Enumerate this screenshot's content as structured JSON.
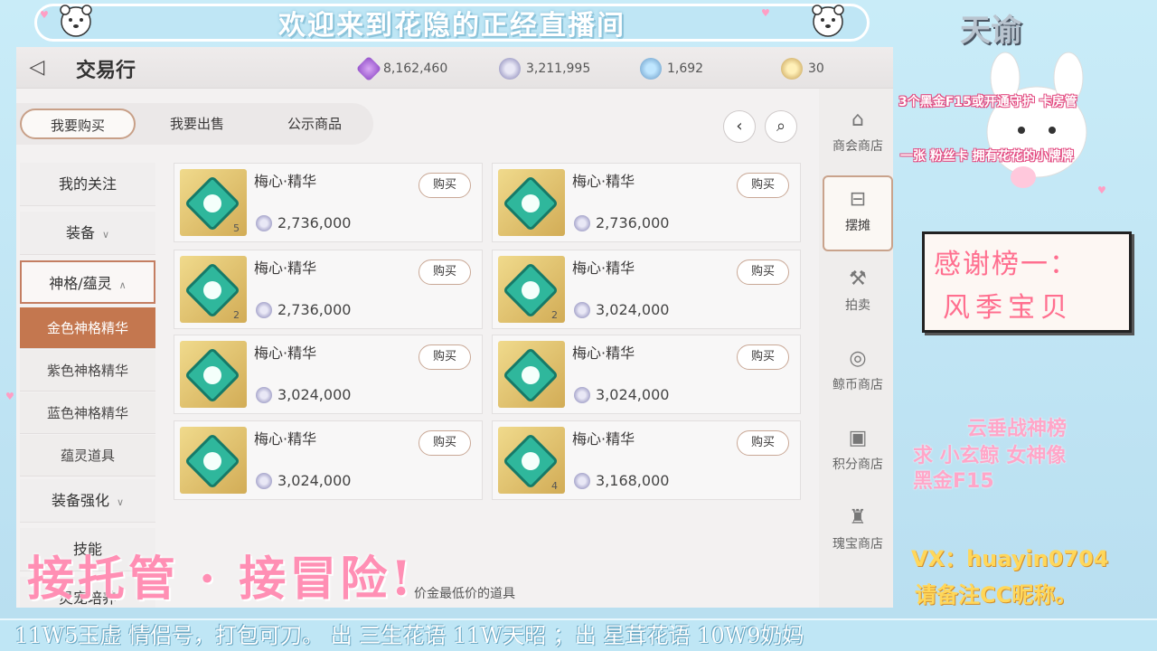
{
  "stream": {
    "banner_title": "欢迎来到花隐的正经直播间",
    "overlay_big": "接托管 · 接冒险!",
    "ticker": "11W5玉虚   情侣号，打包可刀。    出  三生花语  11W天昭 ；出  星茸花语  10W9奶妈",
    "logo": "天谕",
    "right_note_1": "3个黑金F15或开通守护 卡房管",
    "right_note_2": "一张 粉丝卡 拥有花花的小牌牌",
    "thanks_title": "感谢榜一：",
    "thanks_name": "风季宝贝",
    "pink_line_1": "云垂战神榜",
    "pink_line_2": "求   小玄鲸 女神像",
    "pink_line_3": "黑金F15",
    "vx_line_1": "VX：huayin0704",
    "vx_line_2": "请备注CC昵称。"
  },
  "game": {
    "title": "交易行",
    "currencies": [
      {
        "icon": "purple-crystal-icon",
        "value": "8,162,460"
      },
      {
        "icon": "silver-coin-icon",
        "value": "3,211,995"
      },
      {
        "icon": "blue-coin-icon",
        "value": "1,692"
      },
      {
        "icon": "gold-coin-icon",
        "value": "30"
      }
    ],
    "tabs": [
      "我要购买",
      "我要出售",
      "公示商品"
    ],
    "sidebar": {
      "follow": "我的关注",
      "equipment": "装备",
      "divinity": "神格/蕴灵",
      "subs": [
        "金色神格精华",
        "紫色神格精华",
        "蓝色神格精华",
        "蕴灵道具"
      ],
      "enhance": "装备强化",
      "skill": "技能",
      "pet": "灵宠培养"
    },
    "items": [
      {
        "name": "梅心·精华",
        "price": "2,736,000",
        "count": "5",
        "buy": "购买"
      },
      {
        "name": "梅心·精华",
        "price": "2,736,000",
        "count": "",
        "buy": "购买"
      },
      {
        "name": "梅心·精华",
        "price": "2,736,000",
        "count": "2",
        "buy": "购买"
      },
      {
        "name": "梅心·精华",
        "price": "3,024,000",
        "count": "2",
        "buy": "购买"
      },
      {
        "name": "梅心·精华",
        "price": "3,024,000",
        "count": "",
        "buy": "购买"
      },
      {
        "name": "梅心·精华",
        "price": "3,024,000",
        "count": "",
        "buy": "购买"
      },
      {
        "name": "梅心·精华",
        "price": "3,024,000",
        "count": "",
        "buy": "购买"
      },
      {
        "name": "梅心·精华",
        "price": "3,168,000",
        "count": "4",
        "buy": "购买"
      }
    ],
    "shops": [
      "商会商店",
      "摆摊",
      "拍卖",
      "鲸币商店",
      "积分商店",
      "瑰宝商店"
    ],
    "footer_hint": "价金最低价的道具"
  }
}
